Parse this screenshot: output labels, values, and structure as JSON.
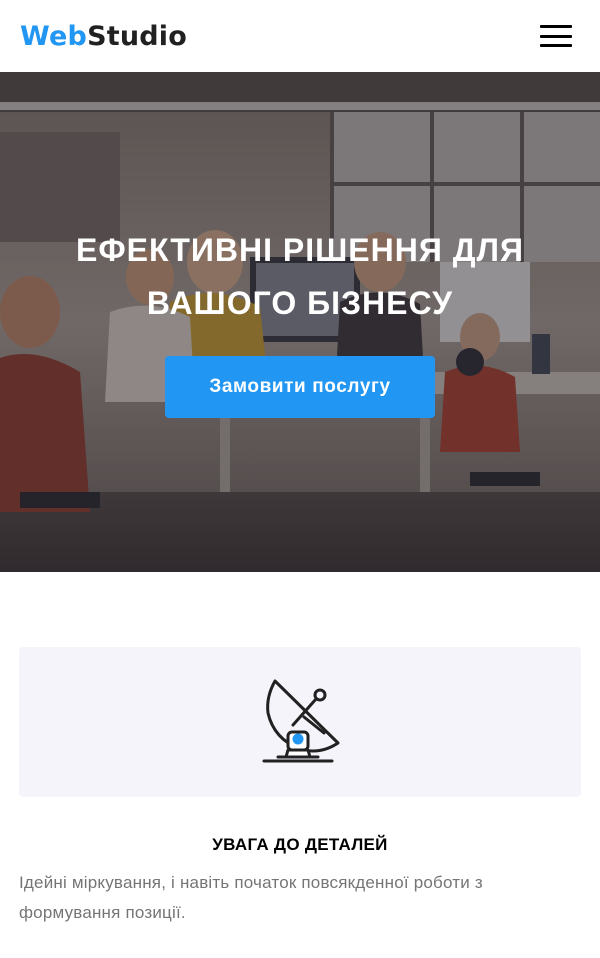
{
  "header": {
    "logo_part1": "Web",
    "logo_part2": "Studio",
    "menu_icon": "hamburger-menu-icon"
  },
  "hero": {
    "title": "ЕФЕКТИВНІ РІШЕННЯ ДЛЯ ВАШОГО БІЗНЕСУ",
    "button_label": "Замовити послугу",
    "background": "office-team-photo"
  },
  "feature": {
    "icon": "satellite-dish-icon",
    "title": "УВАГА ДО ДЕТАЛЕЙ",
    "text": "Ідейні міркування, і навіть початок повсякденної роботи з формування позиції."
  },
  "colors": {
    "accent": "#2196f3",
    "text_dark": "#212121",
    "text_muted": "#757575",
    "card_bg": "#f5f4fa"
  }
}
